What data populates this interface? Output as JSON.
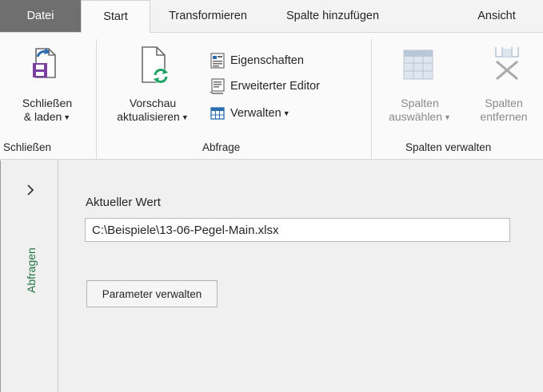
{
  "tabs": [
    {
      "label": "Datei"
    },
    {
      "label": "Start"
    },
    {
      "label": "Transformieren"
    },
    {
      "label": "Spalte hinzufügen"
    },
    {
      "label": "Ansicht"
    }
  ],
  "ribbon": {
    "close_load": {
      "line1": "Schließen",
      "line2": "& laden"
    },
    "refresh": {
      "line1": "Vorschau",
      "line2": "aktualisieren"
    },
    "properties": "Eigenschaften",
    "advanced_editor": "Erweiterter Editor",
    "manage": "Verwalten",
    "choose_cols": {
      "line1": "Spalten",
      "line2": "auswählen"
    },
    "remove_cols": {
      "line1": "Spalten",
      "line2": "entfernen"
    },
    "groups": {
      "close": "Schließen",
      "query": "Abfrage",
      "manage_cols": "Spalten verwalten"
    }
  },
  "queries_pane": {
    "label": "Abfragen"
  },
  "parameter": {
    "current_value_label": "Aktueller Wert",
    "current_value": "C:\\Beispiele\\13-06-Pegel-Main.xlsx",
    "manage_button": "Parameter verwalten"
  },
  "colors": {
    "file_tab": "#6f6f6f",
    "accent_green": "#217346",
    "icon_blue": "#2b6cb0"
  }
}
